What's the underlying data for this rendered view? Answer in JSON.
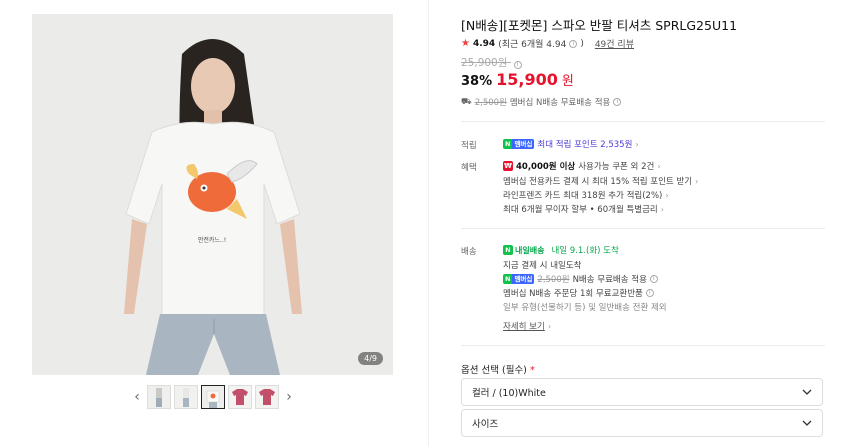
{
  "gallery": {
    "page_indicator": "4/9",
    "thumbnails": [
      {
        "name": "thumb-1",
        "active": false
      },
      {
        "name": "thumb-2",
        "active": false
      },
      {
        "name": "thumb-3",
        "active": true
      },
      {
        "name": "thumb-4",
        "active": false
      },
      {
        "name": "thumb-5",
        "active": false
      }
    ],
    "prev_icon": "chevron-left-icon",
    "next_icon": "chevron-right-icon",
    "shirt_print_text": "안전카느..!"
  },
  "product": {
    "title": "[N배송][포켓몬] 스파오 반팔 티셔츠 SPRLG25U11",
    "rating": "4.94",
    "rating_detail": "(최근 6개월 4.94",
    "reviews": "49건 리뷰",
    "original_price": "25,900원",
    "discount": "38%",
    "price": "15,900",
    "price_unit": "원",
    "shipping_line": {
      "crossed": "2,500원",
      "text": "멤버십 N배송 무료배송 적용"
    }
  },
  "benefits": {
    "point_label": "적립",
    "point_text": "최대 적립 포인트 2,535원",
    "benefit_label": "혜택",
    "coupon_bold": "40,000원 이상",
    "coupon_text": "사용가능 쿠폰 외 2건",
    "card_text": "멤버십 전용카드 결제 시 최대 15% 적립 포인트 받기",
    "line_friends_text": "라인프렌즈 카드 최대 318원 추가 적립(2%)",
    "installment_text": "최대 6개월 무이자 할부 • 60개월 특별금리"
  },
  "delivery": {
    "label": "배송",
    "badge": "내일배송",
    "arrival": "내일 9.1.(화) 도착",
    "order_now": "지금 결제 시 내일도착",
    "member_crossed": "2,500원",
    "member_text": "N배송 무료배송 적용",
    "exchange_text": "멤버십 N배송 주문당 1회 무료교환반품",
    "exclude_text": "일부 유형(선물하기 등) 및 일반배송 전환 제외",
    "detail_link": "자세히 보기"
  },
  "options": {
    "title": "옵션 선택 (필수)",
    "required_mark": "*",
    "color_value": "컬러 / (10)White",
    "size_placeholder": "사이즈"
  },
  "colors": {
    "accent_red": "#e5132b",
    "n_green": "#0ec24a",
    "membership_blue": "#3b67ff",
    "point_purple": "#4b3ad6"
  }
}
